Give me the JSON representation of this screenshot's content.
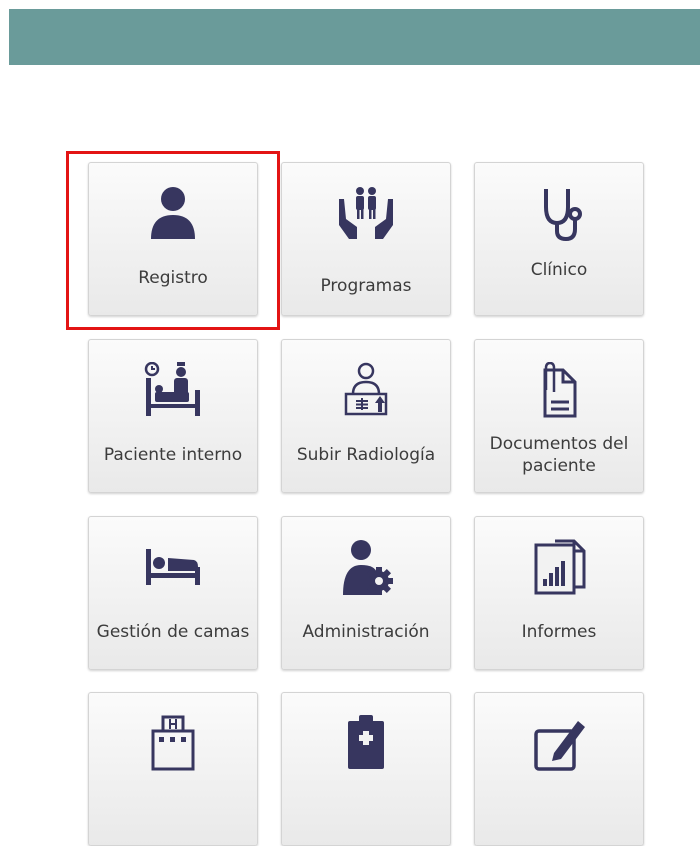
{
  "colors": {
    "header": "#6a9b9a",
    "highlight": "#e31414",
    "icon": "#37365f"
  },
  "tiles": [
    {
      "label": "Registro",
      "icon": "user-icon",
      "highlighted": true
    },
    {
      "label": "Programas",
      "icon": "family-hands-icon"
    },
    {
      "label": "Clínico",
      "icon": "stethoscope-icon"
    },
    {
      "label": "Paciente interno",
      "icon": "inpatient-bed-icon"
    },
    {
      "label": "Subir Radiología",
      "icon": "radiology-upload-icon"
    },
    {
      "label": "Documentos del paciente",
      "icon": "document-attachment-icon"
    },
    {
      "label": "Gestión de camas",
      "icon": "bed-icon"
    },
    {
      "label": "Administración",
      "icon": "admin-gear-icon"
    },
    {
      "label": "Informes",
      "icon": "reports-icon"
    },
    {
      "label": "",
      "icon": "hospital-icon"
    },
    {
      "label": "",
      "icon": "clipboard-medical-icon"
    },
    {
      "label": "",
      "icon": "edit-icon"
    }
  ]
}
